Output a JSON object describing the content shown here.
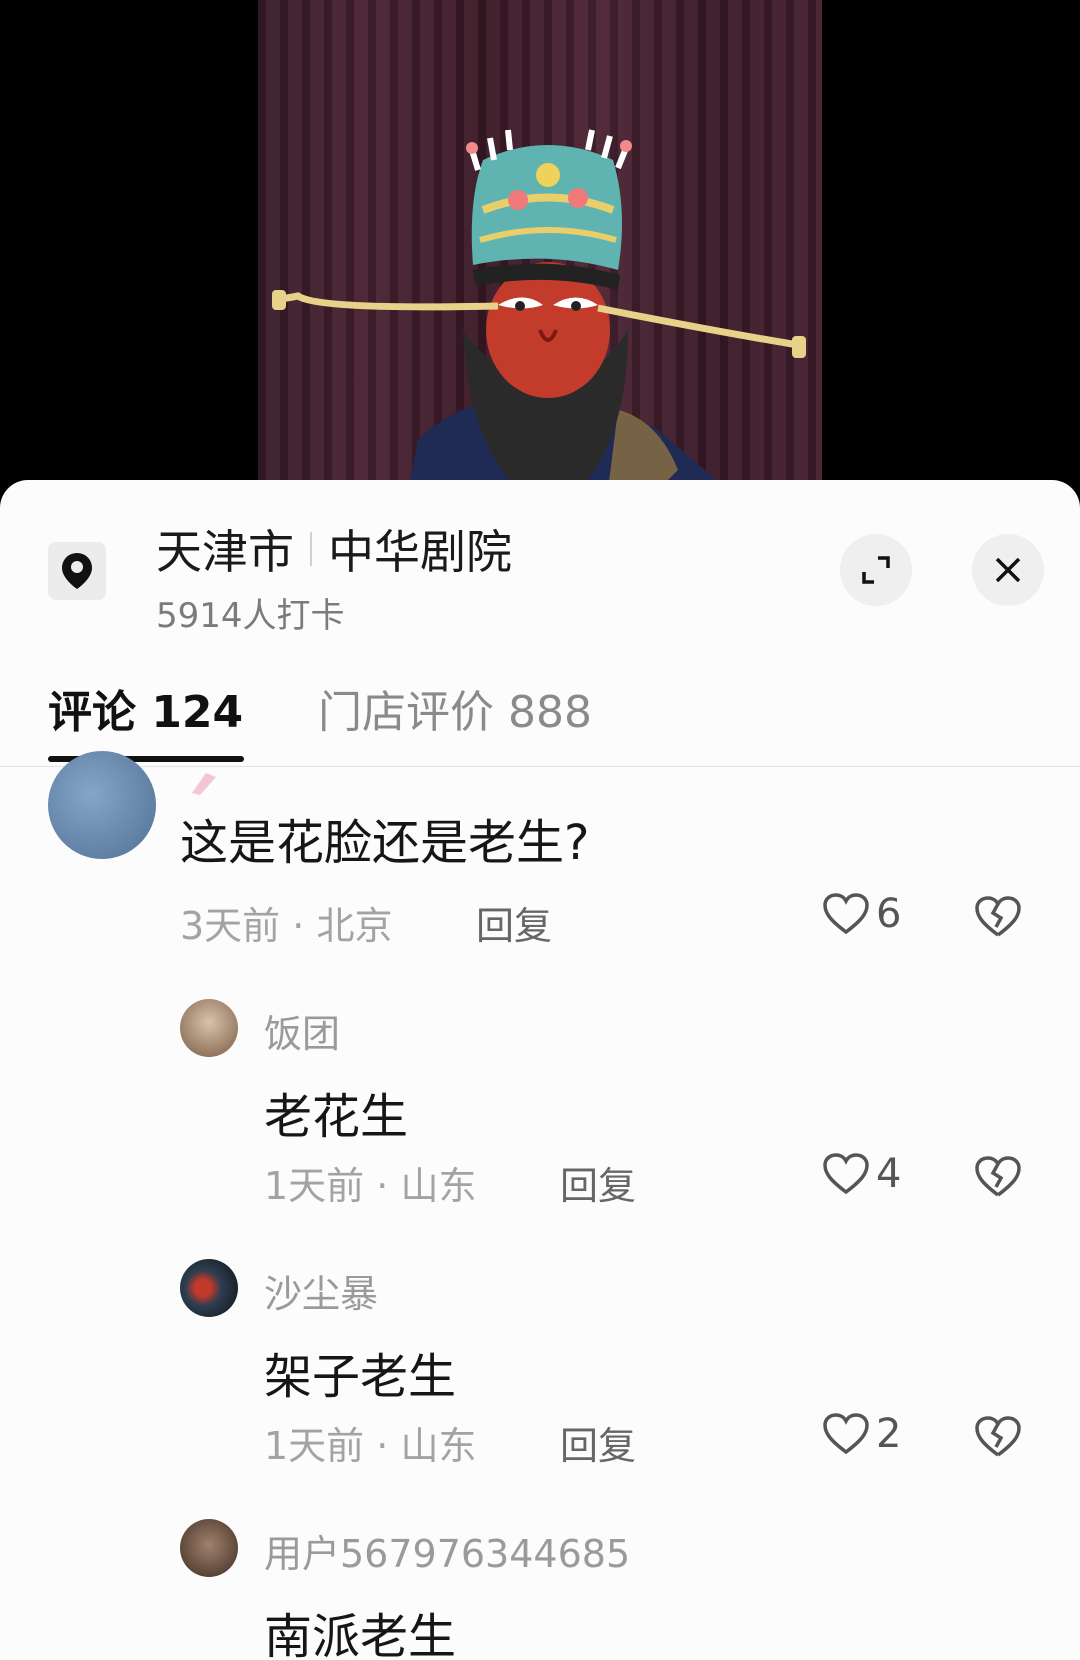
{
  "location": {
    "city": "天津市",
    "venue": "中华剧院",
    "checkins": "5914人打卡"
  },
  "tabs": [
    {
      "label": "评论 124",
      "active": true
    },
    {
      "label": "门店评价 888",
      "active": false
    }
  ],
  "comments": [
    {
      "text": "这是花脸还是老生?",
      "time": "3天前",
      "region": "北京",
      "reply": "回复",
      "likes": "6"
    },
    {
      "name": "饭团",
      "text": "老花生",
      "time": "1天前",
      "region": "山东",
      "reply": "回复",
      "likes": "4"
    },
    {
      "name": "沙尘暴",
      "text": "架子老生",
      "time": "1天前",
      "region": "山东",
      "reply": "回复",
      "likes": "2"
    },
    {
      "name": "用户567976344685",
      "text": "南派老生"
    }
  ],
  "colors": {
    "sheet_bg": "#fcfcfc",
    "text_primary": "#1a1a1a",
    "text_secondary": "#9a9a9a"
  }
}
